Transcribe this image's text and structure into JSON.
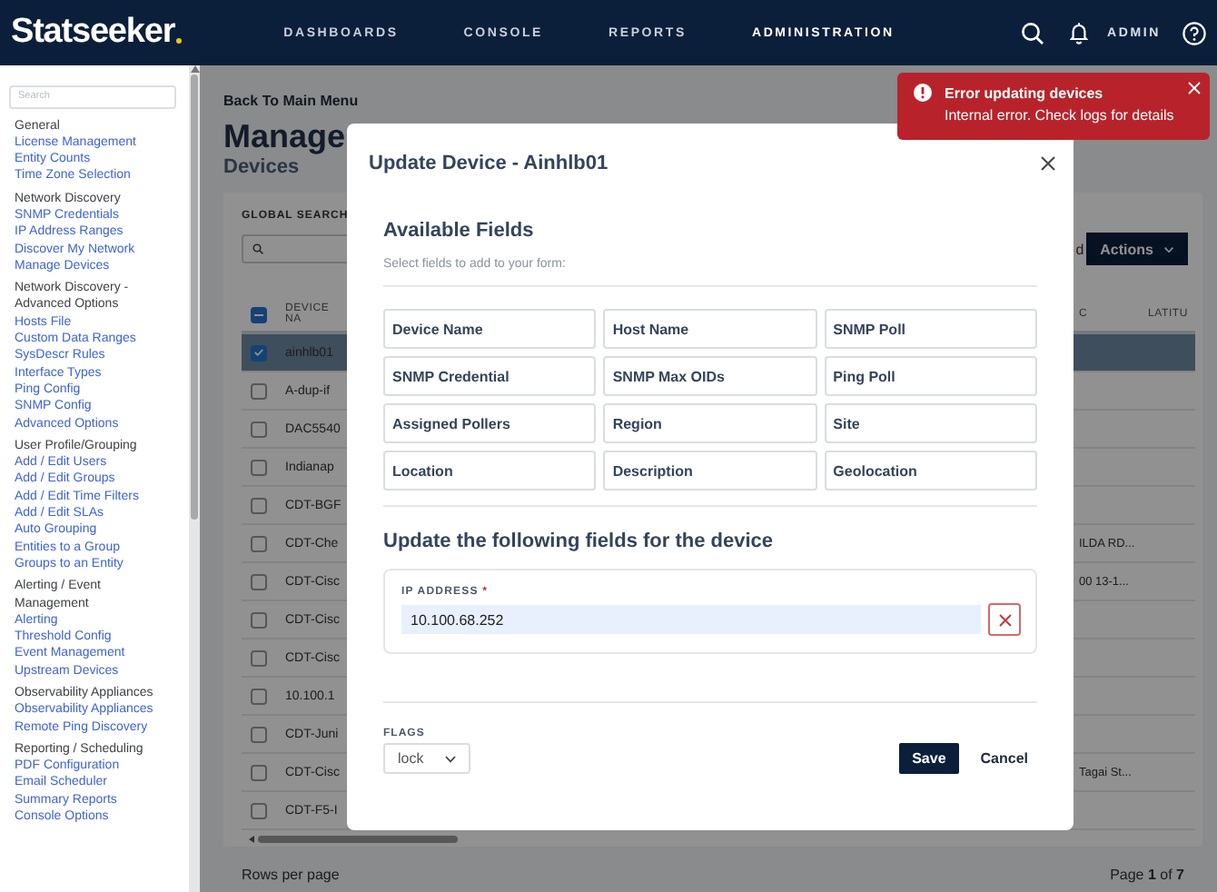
{
  "header": {
    "logo": "Statseeker",
    "nav": [
      {
        "label": "DASHBOARDS",
        "selected": false
      },
      {
        "label": "CONSOLE",
        "selected": false
      },
      {
        "label": "REPORTS",
        "selected": false
      },
      {
        "label": "ADMINISTRATION",
        "selected": true
      }
    ],
    "user": "ADMIN"
  },
  "sidebar": {
    "search": {
      "placeholder": "Search"
    },
    "groups": [
      {
        "heading": "General",
        "items": [
          "License Management",
          "Entity Counts",
          "Time Zone Selection"
        ]
      },
      {
        "heading": "Network Discovery",
        "items": [
          "SNMP Credentials",
          "IP Address Ranges",
          "Discover My Network",
          "Manage Devices"
        ]
      },
      {
        "heading": "Network Discovery - Advanced Options",
        "items": [
          "Hosts File",
          "Custom Data Ranges",
          "SysDescr Rules",
          "Interface Types",
          "Ping Config",
          "SNMP Config",
          "Advanced Options"
        ]
      },
      {
        "heading": "User Profile/Grouping",
        "items": [
          "Add / Edit Users",
          "Add / Edit Groups",
          "Add / Edit Time Filters",
          "Add / Edit SLAs",
          "Auto Grouping",
          "Entities to a Group",
          "Groups to an Entity"
        ]
      },
      {
        "heading": "Alerting / Event Management",
        "items": [
          "Alerting",
          "Threshold Config",
          "Event Management",
          "Upstream Devices"
        ]
      },
      {
        "heading": "Observability Appliances",
        "items": [
          "Observability Appliances",
          "Remote Ping Discovery"
        ]
      },
      {
        "heading": "Reporting / Scheduling",
        "items": [
          "PDF Configuration",
          "Email Scheduler",
          "Summary Reports",
          "Console Options"
        ]
      }
    ]
  },
  "page": {
    "back_link": "Back To Main Menu",
    "title": "Manage",
    "subtitle": "Devices"
  },
  "device_table": {
    "search_label": "GLOBAL SEARCH",
    "toolbar_fragment": "d",
    "actions": "Actions",
    "columns": [
      "DEVICE NA",
      "C",
      "LATITU"
    ],
    "select_all": {
      "indeterminate": true
    },
    "rows": [
      {
        "name": "ainhlb01",
        "selected": true,
        "checked": true
      },
      {
        "name": "A-dup-if",
        "selected": false,
        "checked": false
      },
      {
        "name": "DAC5540",
        "selected": false,
        "checked": false
      },
      {
        "name": "Indianap",
        "selected": false,
        "checked": false
      },
      {
        "name": "CDT-BGF",
        "selected": false,
        "checked": false
      },
      {
        "name": "CDT-Che",
        "selected": false,
        "checked": false,
        "column_c": "ILDA RD..."
      },
      {
        "name": "CDT-Cisc",
        "selected": false,
        "checked": false,
        "column_c": "00 13-1..."
      },
      {
        "name": "CDT-Cisc",
        "selected": false,
        "checked": false
      },
      {
        "name": "CDT-Cisc",
        "selected": false,
        "checked": false
      },
      {
        "name": "10.100.1",
        "selected": false,
        "checked": false
      },
      {
        "name": "CDT-Juni",
        "selected": false,
        "checked": false
      },
      {
        "name": "CDT-Cisc",
        "selected": false,
        "checked": false,
        "column_c": "Tagai St..."
      },
      {
        "name": "CDT-F5-I",
        "selected": false,
        "checked": false
      }
    ],
    "rows_per_page_label": "Rows per page",
    "pagination": "Page **1** of **7**"
  },
  "modal": {
    "title": "Update Device - Ainhlb01",
    "available": {
      "heading": "Available Fields",
      "hint": "Select fields to add to your form:",
      "fields": [
        "Device Name",
        "Host Name",
        "SNMP Poll",
        "SNMP Credential",
        "SNMP Max OIDs",
        "Ping Poll",
        "Assigned Pollers",
        "Region",
        "Site",
        "Location",
        "Description",
        "Geolocation"
      ]
    },
    "update": {
      "heading": "Update the following fields for the device",
      "fields": [
        {
          "label": "IP ADDRESS",
          "required_mark": "*",
          "value": "10.100.68.252"
        }
      ]
    },
    "flags": {
      "label": "FLAGS",
      "value": "lock"
    },
    "buttons": [
      "Save",
      "Cancel"
    ]
  },
  "toast": {
    "title": "Error updating devices",
    "message": "Internal error. Check logs for details"
  }
}
